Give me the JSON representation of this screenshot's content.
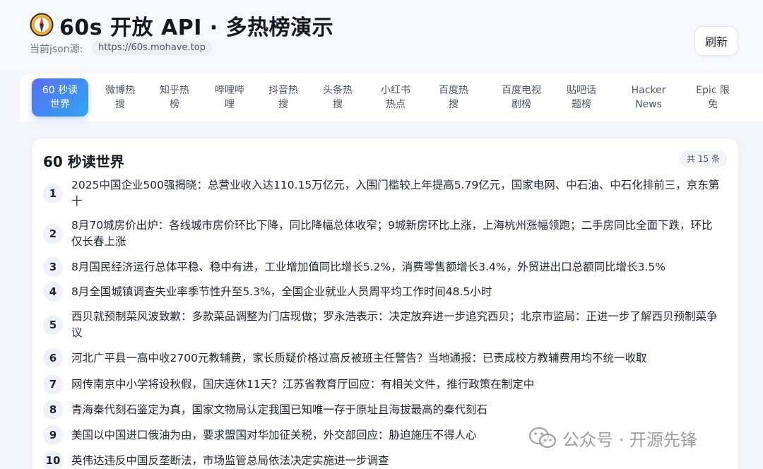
{
  "header": {
    "title": "60s 开放 API · 多热榜演示",
    "source_label": "当前json源:",
    "source_url": "https://60s.mohave.top",
    "refresh_label": "刷新"
  },
  "tabs": [
    {
      "line1": "60 秒读",
      "line2": "世界",
      "active": true
    },
    {
      "line1": "微博热",
      "line2": "搜"
    },
    {
      "line1": "知乎热",
      "line2": "榜"
    },
    {
      "line1": "哔哩哔",
      "line2": "哩"
    },
    {
      "line1": "抖音热",
      "line2": "搜"
    },
    {
      "line1": "头条热",
      "line2": "搜"
    },
    {
      "line1": "小红书",
      "line2": "热点"
    },
    {
      "line1": "百度热",
      "line2": "搜"
    },
    {
      "line1": "百度电视",
      "line2": "剧榜"
    },
    {
      "line1": "贴吧话",
      "line2": "题榜"
    },
    {
      "line1": "Hacker",
      "line2": "News"
    },
    {
      "line1": "Epic 限",
      "line2": "免"
    }
  ],
  "card": {
    "title": "60 秒读世界",
    "count": "共 15 条",
    "items": [
      {
        "num": "1",
        "text": "2025中国企业500强揭晓：总营业收入达110.15万亿元，入围门槛较上年提高5.79亿元，国家电网、中石油、中石化排前三，京东第十"
      },
      {
        "num": "2",
        "text": "8月70城房价出炉：各线城市房价环比下降，同比降幅总体收窄；9城新房环比上涨，上海杭州涨幅领跑；二手房同比全面下跌，环比仅长春上涨"
      },
      {
        "num": "3",
        "text": "8月国民经济运行总体平稳、稳中有进，工业增加值同比增长5.2%，消费零售额增长3.4%，外贸进出口总额同比增长3.5%"
      },
      {
        "num": "4",
        "text": "8月全国城镇调查失业率季节性升至5.3%，全国企业就业人员周平均工作时间48.5小时"
      },
      {
        "num": "5",
        "text": "西贝就预制菜风波致歉：多款菜品调整为门店现做；罗永浩表示：决定放弃进一步追究西贝；北京市监局：正进一步了解西贝预制菜争议"
      },
      {
        "num": "6",
        "text": "河北广平县一高中收2700元教辅费，家长质疑价格过高反被班主任警告？当地通报：已责成校方教辅费用均不统一收取"
      },
      {
        "num": "7",
        "text": "网传南京中小学将设秋假，国庆连休11天？江苏省教育厅回应：有相关文件，推行政策在制定中"
      },
      {
        "num": "8",
        "text": "青海秦代刻石鉴定为真，国家文物局认定我国已知唯一存于原址且海拔最高的秦代刻石"
      },
      {
        "num": "9",
        "text": "美国以中国进口俄油为由，要求盟国对华加征关税，外交部回应：胁迫施压不得人心"
      },
      {
        "num": "10",
        "text": "英伟达违反中国反垄断法，市场监管总局依法决定实施进一步调查"
      }
    ]
  },
  "watermark": {
    "text": "公众号 · 开源先锋"
  },
  "colors": {
    "accent_start": "#5b6cf0",
    "accent_end": "#2fa6f2",
    "background": "#f4f6fb"
  }
}
